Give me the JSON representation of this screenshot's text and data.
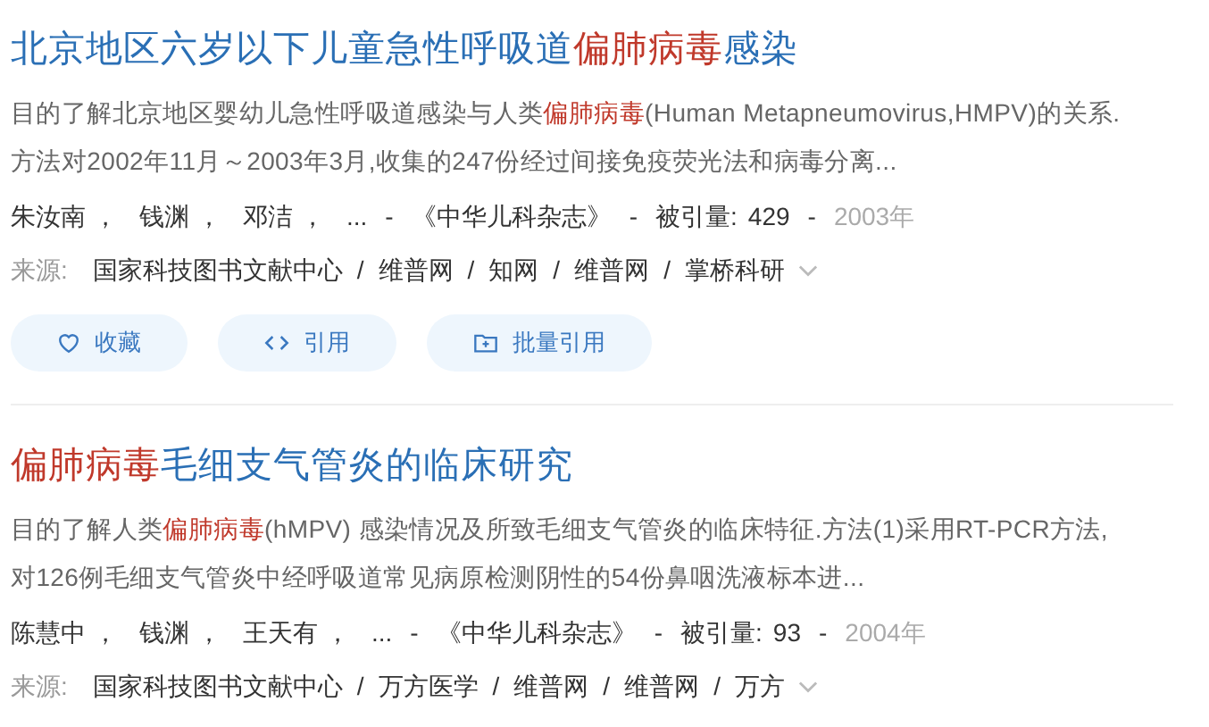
{
  "results": [
    {
      "title": [
        {
          "text": "北京地区六岁以下儿童急性呼吸道",
          "highlight": false
        },
        {
          "text": "偏肺病毒",
          "highlight": true
        },
        {
          "text": "感染",
          "highlight": false
        }
      ],
      "abstract_lines": [
        [
          {
            "text": "目的了解北京地区婴幼儿急性呼吸道感染与人类",
            "highlight": false
          },
          {
            "text": "偏肺病毒",
            "highlight": true
          },
          {
            "text": "(Human Metapneumovirus,HMPV)的关系.",
            "highlight": false
          }
        ],
        [
          {
            "text": "方法对2002年11月～2003年3月,收集的247份经过间接免疫荧光法和病毒分离...",
            "highlight": false
          }
        ]
      ],
      "authors": [
        "朱汝南",
        "钱渊",
        "邓洁"
      ],
      "author_separator": "，",
      "dash": "-",
      "source_separator": "/",
      "more": "...",
      "journal": "《中华儿科杂志》",
      "cited_label": "被引量:",
      "cited": "429",
      "year": "2003年",
      "source_label": "来源:",
      "sources": [
        "国家科技图书文献中心",
        "维普网",
        "知网",
        "维普网",
        "掌桥科研"
      ],
      "actions": [
        {
          "kind": "favorite",
          "label": "收藏"
        },
        {
          "kind": "cite",
          "label": "引用"
        },
        {
          "kind": "batch",
          "label": "批量引用"
        }
      ]
    },
    {
      "title": [
        {
          "text": "偏肺病毒",
          "highlight": true
        },
        {
          "text": "毛细支气管炎的临床研究",
          "highlight": false
        }
      ],
      "abstract_lines": [
        [
          {
            "text": "目的了解人类",
            "highlight": false
          },
          {
            "text": "偏肺病毒",
            "highlight": true
          },
          {
            "text": "(hMPV) 感染情况及所致毛细支气管炎的临床特征.方法(1)采用RT-PCR方法,",
            "highlight": false
          }
        ],
        [
          {
            "text": "对126例毛细支气管炎中经呼吸道常见病原检测阴性的54份鼻咽洗液标本进...",
            "highlight": false
          }
        ]
      ],
      "authors": [
        "陈慧中",
        "钱渊",
        "王天有"
      ],
      "author_separator": "，",
      "dash": "-",
      "source_separator": "/",
      "more": "...",
      "journal": "《中华儿科杂志》",
      "cited_label": "被引量:",
      "cited": "93",
      "year": "2004年",
      "source_label": "来源:",
      "sources": [
        "国家科技图书文献中心",
        "万方医学",
        "维普网",
        "维普网",
        "万方"
      ]
    }
  ]
}
